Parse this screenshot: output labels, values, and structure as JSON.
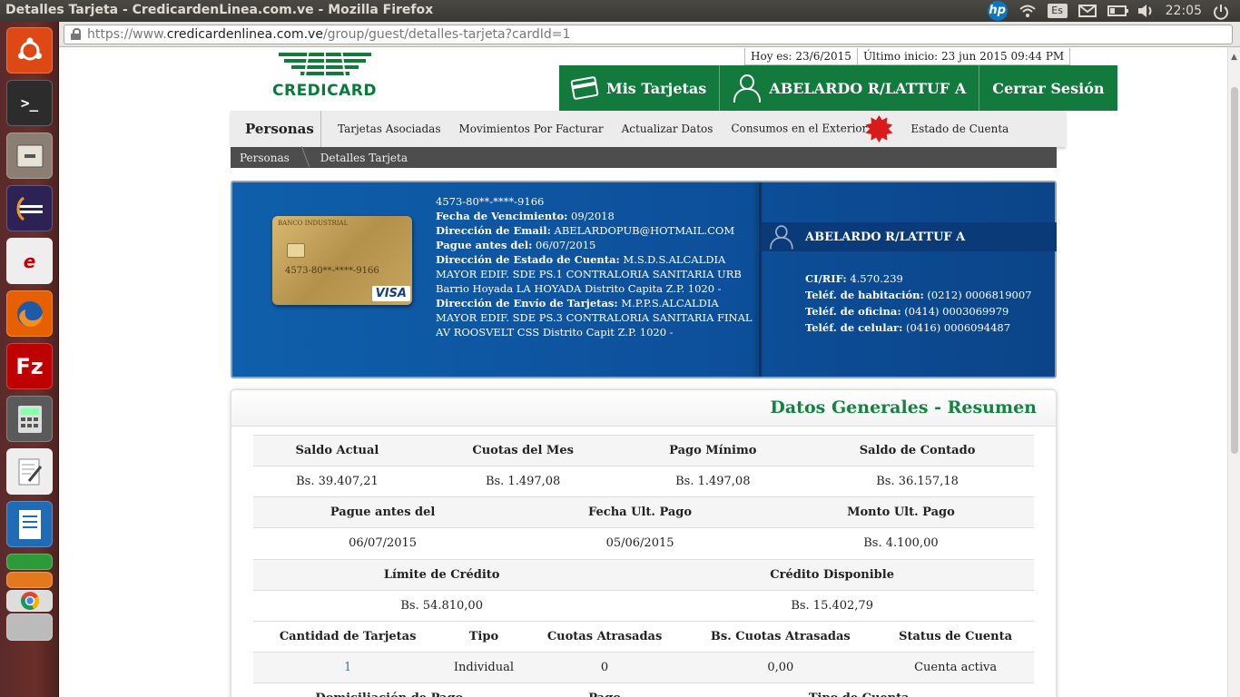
{
  "window": {
    "title": "Detalles Tarjeta - CredicardenLinea.com.ve - Mozilla Firefox",
    "time": "22:05",
    "lang": "Es",
    "hp": "hp"
  },
  "browser": {
    "url_scheme": "https://www.",
    "url_host": "credicardenlinea.com.ve",
    "url_path": "/group/guest/detalles-tarjeta?cardId=1"
  },
  "launcher": [
    "ubuntu-icon",
    "terminal-icon",
    "files-icon",
    "eclipse-icon",
    "evince-icon",
    "firefox-icon",
    "filezilla-icon",
    "calculator-icon",
    "text-editor-icon",
    "writer-icon",
    "calc-icon",
    "impress-icon",
    "chrome-icon",
    "workspaces-icon"
  ],
  "site": {
    "brand": "CREDICARD",
    "today": "Hoy es: 23/6/2015",
    "last_login": "Último inicio: 23 jun 2015 09:44 PM",
    "nav": {
      "cards": "Mis Tarjetas",
      "user": "ABELARDO R/LATTUF A",
      "logout": "Cerrar Sesión"
    },
    "section": "Personas",
    "links": [
      "Tarjetas Asociadas",
      "Movimientos Por Facturar",
      "Actualizar Datos",
      "Consumos en el Exterior",
      "Estado de Cuenta"
    ],
    "breadcrumb": [
      "Personas",
      "Detalles Tarjeta"
    ]
  },
  "card": {
    "image_bank": "BANCO INDUSTRIAL",
    "image_number": "4573-80**-****-9166",
    "image_brand": "VISA",
    "number": "4573-80**-****-9166",
    "expiry_label": "Fecha de Vencimiento:",
    "expiry": " 09/2018",
    "email_label": "Dirección de Email:",
    "email": " ABELARDOPUB@HOTMAIL.COM",
    "pay_before_label": "Pague antes del:",
    "pay_before": " 06/07/2015",
    "statement_addr_label": "Dirección de Estado de Cuenta:",
    "statement_addr": " M.S.D.S.ALCALDIA MAYOR EDIF. SDE PS.1 CONTRALORIA SANITARIA URB Barrio Hoyada LA HOYADA Distrito Capita Z.P. 1020 -",
    "delivery_addr_label": "Dirección de Envío de Tarjetas:",
    "delivery_addr": " M.P.P.S.ALCALDIA MAYOR EDIF. SDE PS.3 CONTRALORIA SANITARIA FINAL AV ROOSVELT CSS Distrito Capit Z.P. 1020 -"
  },
  "owner": {
    "name": "ABELARDO R/LATTUF A",
    "ci_label": "CI/RIF:",
    "ci": " 4.570.239",
    "home_label": "Teléf. de habitación:",
    "home": " (0212) 0006819007",
    "office_label": "Teléf. de oficina:",
    "office": " (0414) 0003069979",
    "mobile_label": "Teléf. de celular:",
    "mobile": " (0416) 0006094487"
  },
  "summary": {
    "title": "Datos Generales - Resumen",
    "row1_labels": [
      "Saldo Actual",
      "Cuotas del Mes",
      "Pago Mínimo",
      "Saldo de Contado"
    ],
    "row1_values": [
      "Bs. 39.407,21",
      "Bs. 1.497,08",
      "Bs. 1.497,08",
      "Bs. 36.157,18"
    ],
    "row2_labels": [
      "Pague antes del",
      "Fecha Ult. Pago",
      "Monto Ult. Pago"
    ],
    "row2_values": [
      "06/07/2015",
      "05/06/2015",
      "Bs. 4.100,00"
    ],
    "row3_labels": [
      "Límite de Crédito",
      "Crédito Disponible"
    ],
    "row3_values": [
      "Bs. 54.810,00",
      "Bs. 15.402,79"
    ],
    "row4_labels": [
      "Cantidad de Tarjetas",
      "Tipo",
      "Cuotas Atrasadas",
      "Bs. Cuotas Atrasadas",
      "Status de Cuenta"
    ],
    "row4_values": [
      "1",
      "Individual",
      "0",
      "0,00",
      "Cuenta activa"
    ],
    "row5_labels": [
      "Domiciliación de Pago",
      "Pago",
      "Tipo de Cuenta"
    ]
  },
  "colors": {
    "brand_green": "#117a3c",
    "card_blue": "#0d4f9a",
    "title_green": "#11853e"
  }
}
